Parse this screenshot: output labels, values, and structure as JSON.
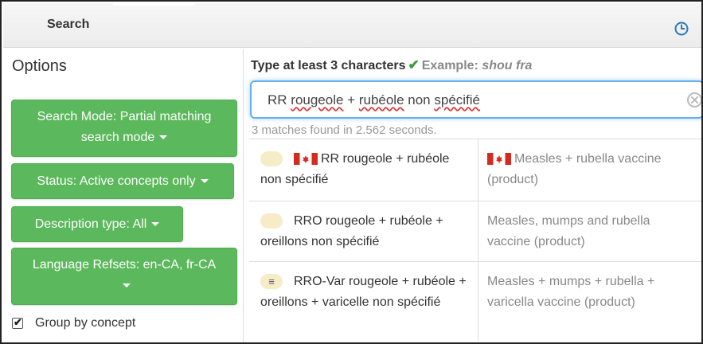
{
  "header": {
    "title": "Search",
    "history_icon": "clock-icon"
  },
  "options": {
    "title": "Options",
    "search_mode_label": "Search Mode: Partial matching search mode",
    "status_label": "Status: Active concepts only",
    "description_type_label": "Description type: All",
    "language_refsets_label": "Language Refsets: en-CA, fr-CA",
    "group_by_concept": {
      "label": "Group by concept",
      "checked": true
    }
  },
  "search": {
    "hint": "Type at least 3 characters",
    "example_label": "Example:",
    "example_value": "shou fra",
    "query_parts": [
      "RR ",
      "rougeole",
      " + ",
      "rubéole",
      " non ",
      "spécifié"
    ],
    "matches_text": "3 matches found in 2.562 seconds."
  },
  "results": [
    {
      "badge": "",
      "flag": "canada-flag-icon",
      "term": "RR rougeole + rubéole non spécifié",
      "concept_flag": "canada-flag-icon",
      "concept": "Measles + rubella vaccine (product)"
    },
    {
      "badge": "",
      "flag": "",
      "term": "RRO rougeole + rubéole + oreillons non spécifié",
      "concept_flag": "",
      "concept": "Measles, mumps and rubella vaccine (product)"
    },
    {
      "badge": "≡",
      "flag": "",
      "term": "RRO-Var rougeole + rubéole + oreillons + varicelle non spécifié",
      "concept_flag": "",
      "concept": "Measles + mumps + rubella + varicella vaccine (product)"
    }
  ],
  "colors": {
    "accent_green": "#5cb85c",
    "focus_blue": "#66afe9",
    "clock_blue": "#2a7ab8",
    "check_green": "#3c9a3c"
  }
}
